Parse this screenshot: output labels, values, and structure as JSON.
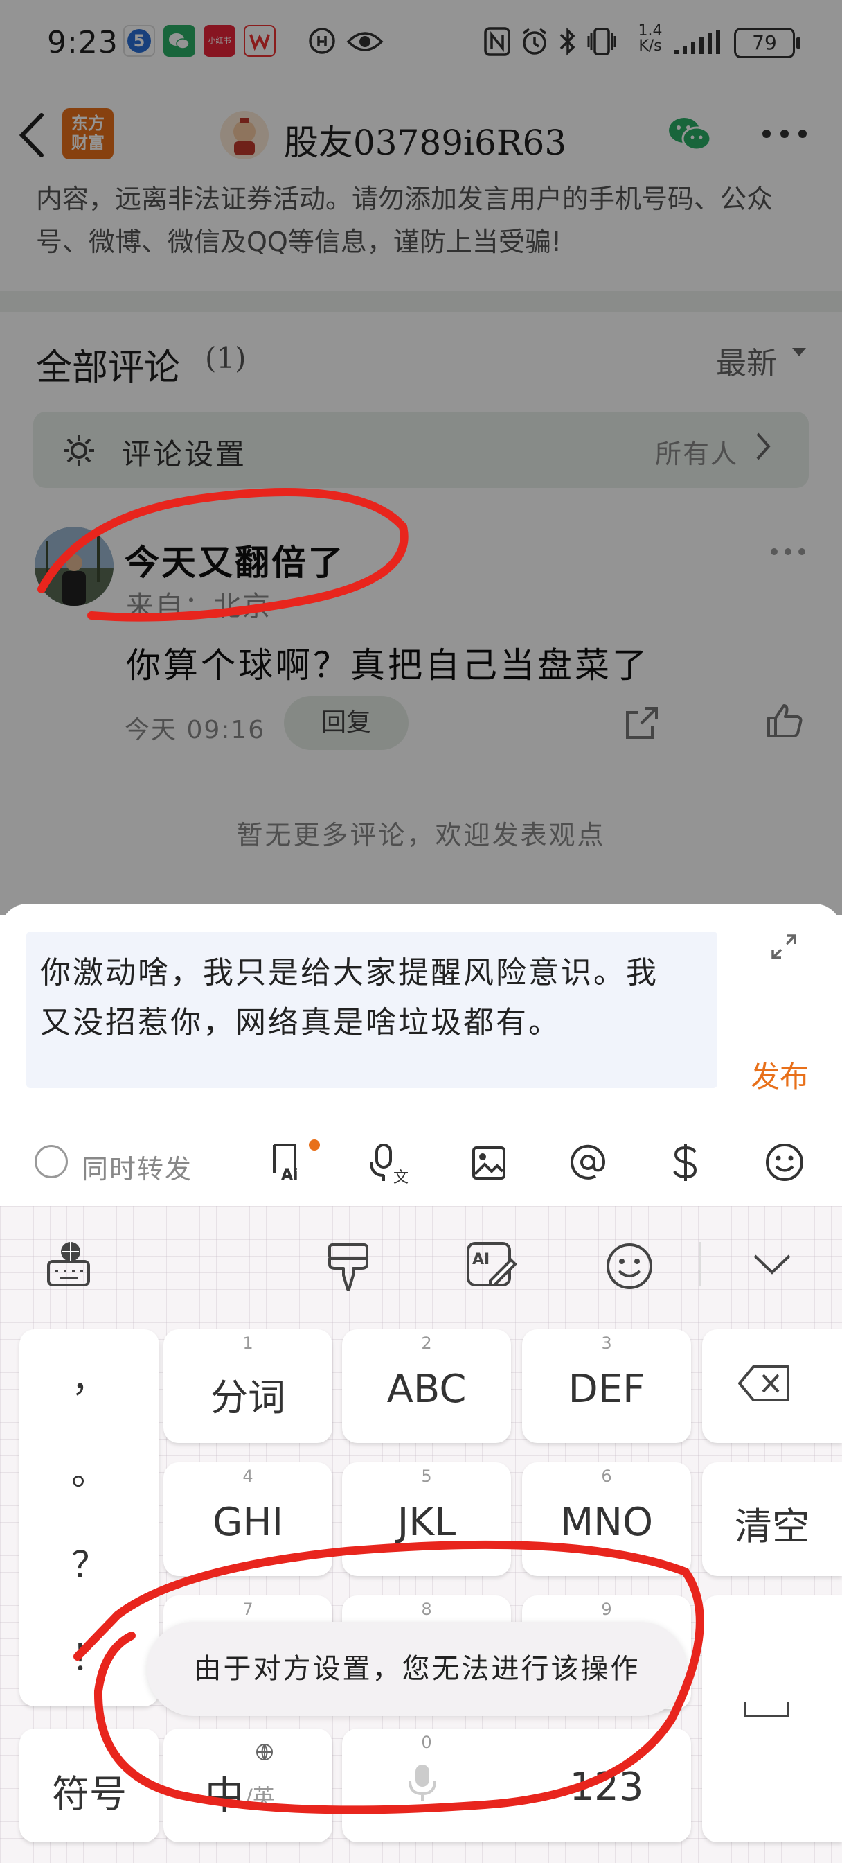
{
  "status_bar": {
    "time": "9:23",
    "network_speed_value": "1.4",
    "network_speed_unit": "K/s",
    "battery": "79",
    "app_icons": [
      "5-channel-icon",
      "wechat-icon",
      "xiaohongshu-icon",
      "wps-icon"
    ],
    "xiaohongshu_label": "小红书"
  },
  "header": {
    "logo_line1": "东方",
    "logo_line2": "财富",
    "title": "股友03789i6R63"
  },
  "notice": {
    "line1": "内容，远离非法证券活动。请勿添加发言用户的手机号码、公众",
    "line2": "号、微博、微信及QQ等信息，谨防上当受骗!"
  },
  "comments_section": {
    "title": "全部评论",
    "count": "(1)",
    "sort_label": "最新",
    "settings_label": "评论设置",
    "settings_value": "所有人",
    "no_more": "暂无更多评论，欢迎发表观点"
  },
  "comment": {
    "username": "今天又翻倍了",
    "location": "来自：北京",
    "body": "你算个球啊？真把自己当盘菜了",
    "time": "今天  09:16",
    "reply_label": "回复"
  },
  "editor": {
    "text_line1": "你激动啥，我只是给大家提醒风险意识。我",
    "text_line2": "又没招惹你，网络真是啥垃圾都有。",
    "publish_label": "发布",
    "repost_label": "同时转发"
  },
  "keyboard": {
    "punct": [
      "，",
      "。",
      "？",
      "！"
    ],
    "keys_row1": [
      {
        "num": "1",
        "label": "分词"
      },
      {
        "num": "2",
        "label": "ABC"
      },
      {
        "num": "3",
        "label": "DEF"
      }
    ],
    "keys_row2": [
      {
        "num": "4",
        "label": "GHI"
      },
      {
        "num": "5",
        "label": "JKL"
      },
      {
        "num": "6",
        "label": "MNO"
      }
    ],
    "keys_row3": [
      {
        "num": "7",
        "label": ""
      },
      {
        "num": "8",
        "label": ""
      },
      {
        "num": "9",
        "label": ""
      }
    ],
    "clear_label": "清空",
    "symbol_label": "符号",
    "lang_main": "中",
    "lang_sub": "/英",
    "zero_num": "0",
    "num_label": "123"
  },
  "toast": "由于对方设置，您无法进行该操作",
  "colors": {
    "accent_orange": "#e8701a",
    "annotation_red": "#e8251d",
    "wechat_green": "#2aae67"
  }
}
